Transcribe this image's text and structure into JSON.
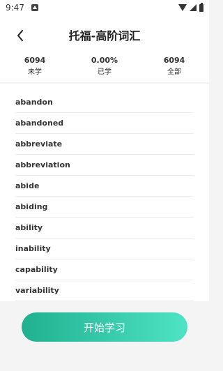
{
  "status_bar": {
    "time": "9:47"
  },
  "header": {
    "title": "托福-高阶词汇"
  },
  "stats": [
    {
      "value": "6094",
      "label": "未学"
    },
    {
      "value": "0.00%",
      "label": "已学"
    },
    {
      "value": "6094",
      "label": "全部"
    }
  ],
  "words": [
    "abandon",
    "abandoned",
    "abbreviate",
    "abbreviation",
    "abide",
    "abiding",
    "ability",
    "inability",
    "capability",
    "variability"
  ],
  "actions": {
    "start_label": "开始学习"
  },
  "colors": {
    "accent_start": "#1fb08f",
    "accent_end": "#4ee3c4"
  }
}
